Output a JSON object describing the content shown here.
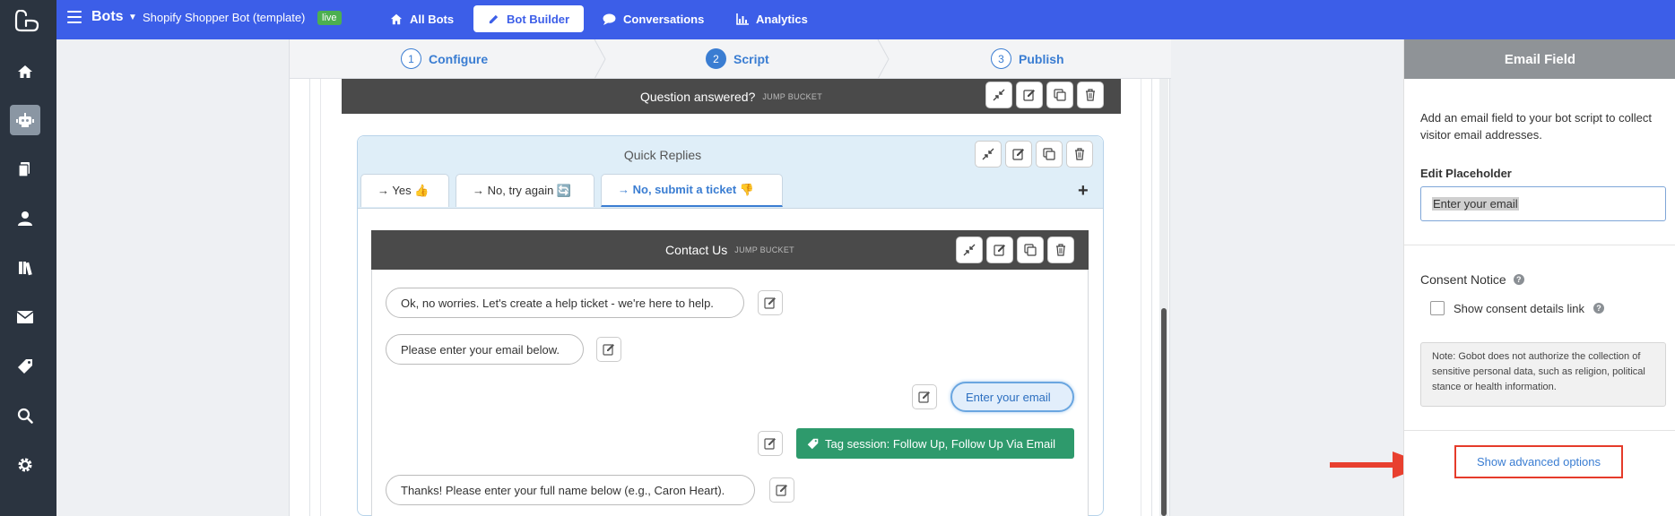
{
  "rail": {
    "logo_icon": "gobot-logo-icon",
    "items": [
      {
        "icon": "home-icon",
        "active": false
      },
      {
        "icon": "robot-icon",
        "active": true
      },
      {
        "icon": "pages-icon",
        "active": false
      },
      {
        "icon": "user-icon",
        "active": false
      },
      {
        "icon": "library-icon",
        "active": false
      },
      {
        "icon": "mail-icon",
        "active": false
      },
      {
        "icon": "tag-icon",
        "active": false
      },
      {
        "icon": "search-icon",
        "active": false
      },
      {
        "icon": "gear-icon",
        "active": false
      }
    ]
  },
  "topbar": {
    "section": "Bots",
    "bot_name": "Shopify Shopper Bot (template)",
    "status_badge": "live",
    "tabs": [
      {
        "label": "All Bots",
        "icon": "home-icon",
        "active": false
      },
      {
        "label": "Bot Builder",
        "icon": "pencil-icon",
        "active": true
      },
      {
        "label": "Conversations",
        "icon": "chat-icon",
        "active": false
      },
      {
        "label": "Analytics",
        "icon": "chart-icon",
        "active": false
      }
    ],
    "brand_color": "#3c5ee8"
  },
  "steps": [
    {
      "num": "1",
      "label": "Configure",
      "active": false
    },
    {
      "num": "2",
      "label": "Script",
      "active": true
    },
    {
      "num": "3",
      "label": "Publish",
      "active": false
    }
  ],
  "editor": {
    "top_bucket": {
      "title": "Question answered?",
      "subtitle": "JUMP BUCKET"
    },
    "quick_replies": {
      "title": "Quick Replies",
      "tabs": [
        {
          "label": "→ Yes 👍",
          "active": false
        },
        {
          "label": "→ No, try again 🔄",
          "active": false
        },
        {
          "label": "→ No, submit a ticket 👎",
          "active": true
        }
      ],
      "add_symbol": "+"
    },
    "contact_bucket": {
      "title": "Contact Us",
      "subtitle": "JUMP BUCKET"
    },
    "messages": {
      "m1": "Ok, no worries. Let's create a help ticket - we're here to help.",
      "m2": "Please enter your email below.",
      "email_field": "Enter your email",
      "tag": "Tag session: Follow Up, Follow Up Via Email",
      "m3": "Thanks! Please enter your full name below (e.g., Caron Heart)."
    }
  },
  "panel": {
    "title": "Email Field",
    "description": "Add an email field to your bot script to collect visitor email addresses.",
    "placeholder_label": "Edit Placeholder",
    "placeholder_value": "Enter your email",
    "consent_title": "Consent Notice",
    "consent_checkbox": "Show consent details link",
    "note": "Note: Gobot does not authorize the collection of sensitive personal data, such as religion, political stance or health information.",
    "advanced_link": "Show advanced options"
  }
}
